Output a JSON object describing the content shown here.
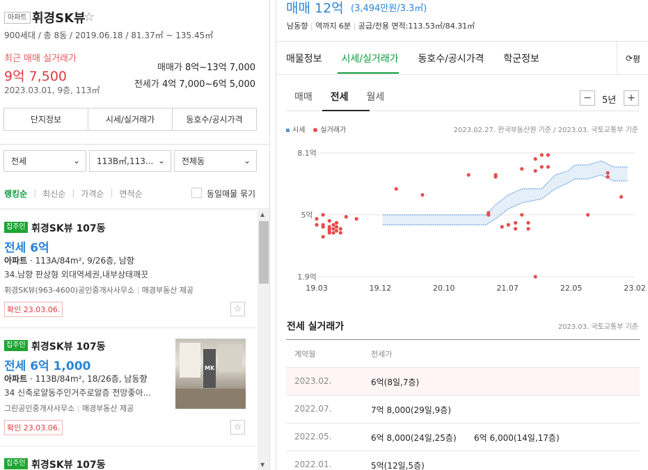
{
  "complex": {
    "type_badge": "아파트",
    "name": "휘경SK뷰",
    "star_icon": "star-outline-icon",
    "summary": "900세대 / 총 8동 / 2019.06.18 / 81.37㎡ ~ 135.45㎡",
    "recent_label": "최근 매매 실거래가",
    "recent_price": "9억 7,500",
    "recent_date": "2023.03.01, 9층, 113㎡",
    "sale_label": "매매가",
    "sale_range": "8억~13억 7,000",
    "jeonse_label": "전세가",
    "jeonse_range": "4억 7,000~6억 5,000"
  },
  "left_tabs": [
    "단지정보",
    "시세/실거래가",
    "동호수/공시가격"
  ],
  "filters": {
    "trade": "전세",
    "area": "113B㎡,113...",
    "dong": "전체동",
    "chevron_icon": "chevron-down-icon"
  },
  "sort": {
    "items": [
      "랭킹순",
      "최신순",
      "가격순",
      "면적순"
    ],
    "active": "랭킹순",
    "same_listing": "동일매물 묶기"
  },
  "listings": [
    {
      "tag": "집주인",
      "title": "휘경SK뷰 107동",
      "price": "전세 6억",
      "type": "아파트",
      "info": "113A/84m², 9/26층, 남향",
      "desc": "34.남향 판상형 외대역세권,내부상태깨끗",
      "agent": "휘경SK뷰(963-4600)공인중개사사무소",
      "provider": "매경부동산 제공",
      "confirm": "확인 23.03.06."
    },
    {
      "tag": "집주인",
      "title": "휘경SK뷰 107동",
      "price": "전세 6억 1,000",
      "type": "아파트",
      "info": "113B/84m², 18/26층, 남동향",
      "desc": "34 신축로얄동주인거주로알층 전망좋아...",
      "agent": "그린공인중개사사무소",
      "provider": "매경부동산 제공",
      "confirm": "확인 23.03.06.",
      "photo_watermark": "MK"
    },
    {
      "tag": "집주인",
      "title": "휘경SK뷰 107동"
    }
  ],
  "detail": {
    "headline_price": "매매 12억",
    "headline_sub": "(3,494만원/3.3㎡)",
    "meta": [
      "남동향",
      "역까지 6분",
      "공급/전용 면적:113.53㎡/84.31㎡"
    ],
    "tabs": [
      "매물정보",
      "시세/실거래가",
      "동호수/공시가격",
      "학군정보"
    ],
    "active_tab": "시세/실거래가",
    "side_button": "평",
    "side_icon": "refresh-icon",
    "sub_tabs": [
      "매매",
      "전세",
      "월세"
    ],
    "active_sub_tab": "전세",
    "period": "5년",
    "minus_label": "−",
    "plus_label": "+",
    "legend_market": "시세",
    "legend_actual": "실거래가",
    "source_note": "2023.02.27. 한국부동산원 기준 / 2023.03. 국토교통부 기준"
  },
  "chart_data": {
    "type": "scatter",
    "y_ticks": [
      "8.1억",
      "5억",
      "1.9억"
    ],
    "ylim": [
      1.9,
      8.1
    ],
    "x_ticks": [
      "19.03",
      "19.12",
      "20.10",
      "21.07",
      "22.05",
      "23.02"
    ],
    "xlim": [
      2019.17,
      2023.17
    ],
    "grid": true,
    "legend_position": "top-left",
    "colors": {
      "market": "#5b93d9",
      "market_band": "#d9e8f8",
      "actual": "#e84c4c"
    },
    "series": [
      {
        "name": "시세",
        "type": "area-band",
        "x": [
          2020.0,
          2021.3,
          2021.42,
          2021.58,
          2021.75,
          2022.0,
          2022.17,
          2022.33,
          2022.42,
          2022.58,
          2022.75,
          2022.9,
          2023.0,
          2023.08
        ],
        "upper": [
          5.0,
          5.0,
          5.5,
          6.0,
          6.3,
          6.3,
          7.0,
          7.2,
          7.5,
          7.5,
          7.7,
          7.4,
          7.4,
          7.4
        ],
        "lower": [
          4.5,
          4.5,
          4.8,
          5.3,
          5.6,
          5.8,
          6.3,
          6.6,
          6.8,
          6.8,
          7.0,
          6.7,
          6.7,
          6.7
        ]
      },
      {
        "name": "실거래가",
        "type": "scatter",
        "points": [
          [
            2019.17,
            4.8
          ],
          [
            2019.17,
            4.5
          ],
          [
            2019.25,
            5.0
          ],
          [
            2019.25,
            4.4
          ],
          [
            2019.25,
            4.5
          ],
          [
            2019.25,
            3.9
          ],
          [
            2019.33,
            4.1
          ],
          [
            2019.33,
            4.3
          ],
          [
            2019.33,
            4.7
          ],
          [
            2019.33,
            4.4
          ],
          [
            2019.33,
            4.2
          ],
          [
            2019.38,
            4.3
          ],
          [
            2019.38,
            4.1
          ],
          [
            2019.38,
            4.5
          ],
          [
            2019.42,
            4.2
          ],
          [
            2019.42,
            4.4
          ],
          [
            2019.42,
            4.6
          ],
          [
            2019.47,
            4.3
          ],
          [
            2019.47,
            4.1
          ],
          [
            2019.54,
            4.9
          ],
          [
            2019.67,
            4.8
          ],
          [
            2020.17,
            6.3
          ],
          [
            2020.5,
            6.0
          ],
          [
            2021.08,
            7.0
          ],
          [
            2021.33,
            5.0
          ],
          [
            2021.33,
            5.1
          ],
          [
            2021.42,
            7.0
          ],
          [
            2021.42,
            6.9
          ],
          [
            2021.5,
            4.4
          ],
          [
            2021.58,
            4.5
          ],
          [
            2021.67,
            4.6
          ],
          [
            2021.67,
            4.3
          ],
          [
            2021.75,
            7.3
          ],
          [
            2021.75,
            5.0
          ],
          [
            2021.83,
            4.3
          ],
          [
            2021.83,
            4.6
          ],
          [
            2021.92,
            7.8
          ],
          [
            2021.92,
            7.2
          ],
          [
            2021.92,
            1.9
          ],
          [
            2022.0,
            7.4
          ],
          [
            2022.0,
            8.0
          ],
          [
            2022.08,
            8.0
          ],
          [
            2022.08,
            7.4
          ],
          [
            2022.58,
            5.0
          ],
          [
            2022.83,
            6.9
          ],
          [
            2022.83,
            7.1
          ],
          [
            2023.0,
            5.9
          ]
        ]
      }
    ]
  },
  "trades": {
    "title": "전세 실거래가",
    "source": "2023.03. 국토교통부 기준",
    "col_date": "계약월",
    "col_price": "전세가",
    "rows": [
      {
        "date": "2023.02.",
        "a": "6억(8일,7층)",
        "b": ""
      },
      {
        "date": "2022.07.",
        "a": "7억 8,000(29일,9층)",
        "b": ""
      },
      {
        "date": "2022.05.",
        "a": "6억 8,000(24일,25층)",
        "b": "6억 6,000(14일,17층)"
      },
      {
        "date": "2022.01.",
        "a": "5억(12일,5층)",
        "b": ""
      }
    ]
  }
}
